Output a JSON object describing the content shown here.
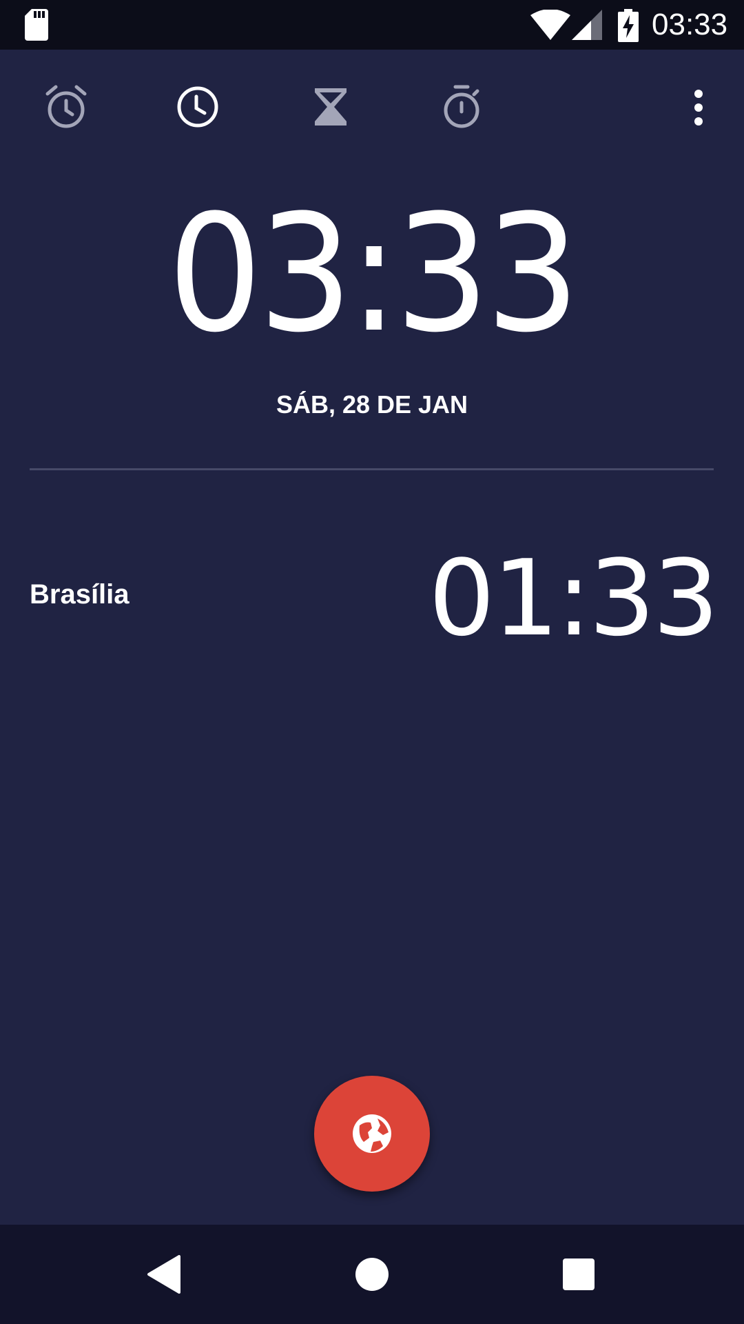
{
  "status_bar": {
    "time": "03:33",
    "icons": [
      "sd-card-icon",
      "wifi-icon",
      "cell-signal-icon",
      "battery-charging-icon"
    ]
  },
  "tabs": [
    {
      "name": "alarm",
      "icon": "alarm-clock-icon",
      "active": false
    },
    {
      "name": "clock",
      "icon": "clock-icon",
      "active": true
    },
    {
      "name": "timer",
      "icon": "hourglass-icon",
      "active": false
    },
    {
      "name": "stopwatch",
      "icon": "stopwatch-icon",
      "active": false
    }
  ],
  "overflow_icon": "more-vert-icon",
  "clock": {
    "time": "03:33",
    "date": "SÁB, 28 DE JAN"
  },
  "world_clocks": [
    {
      "city": "Brasília",
      "time": "01:33"
    }
  ],
  "fab": {
    "icon": "globe-icon"
  },
  "navigation": {
    "icons": [
      "back-icon",
      "home-icon",
      "recents-icon"
    ]
  },
  "colors": {
    "background": "#202343",
    "status_bar": "#0c0d19",
    "nav_bar": "#12132a",
    "fab": "#dc4438",
    "active_icon": "#ffffff",
    "inactive_icon": "#a3a5b8"
  }
}
